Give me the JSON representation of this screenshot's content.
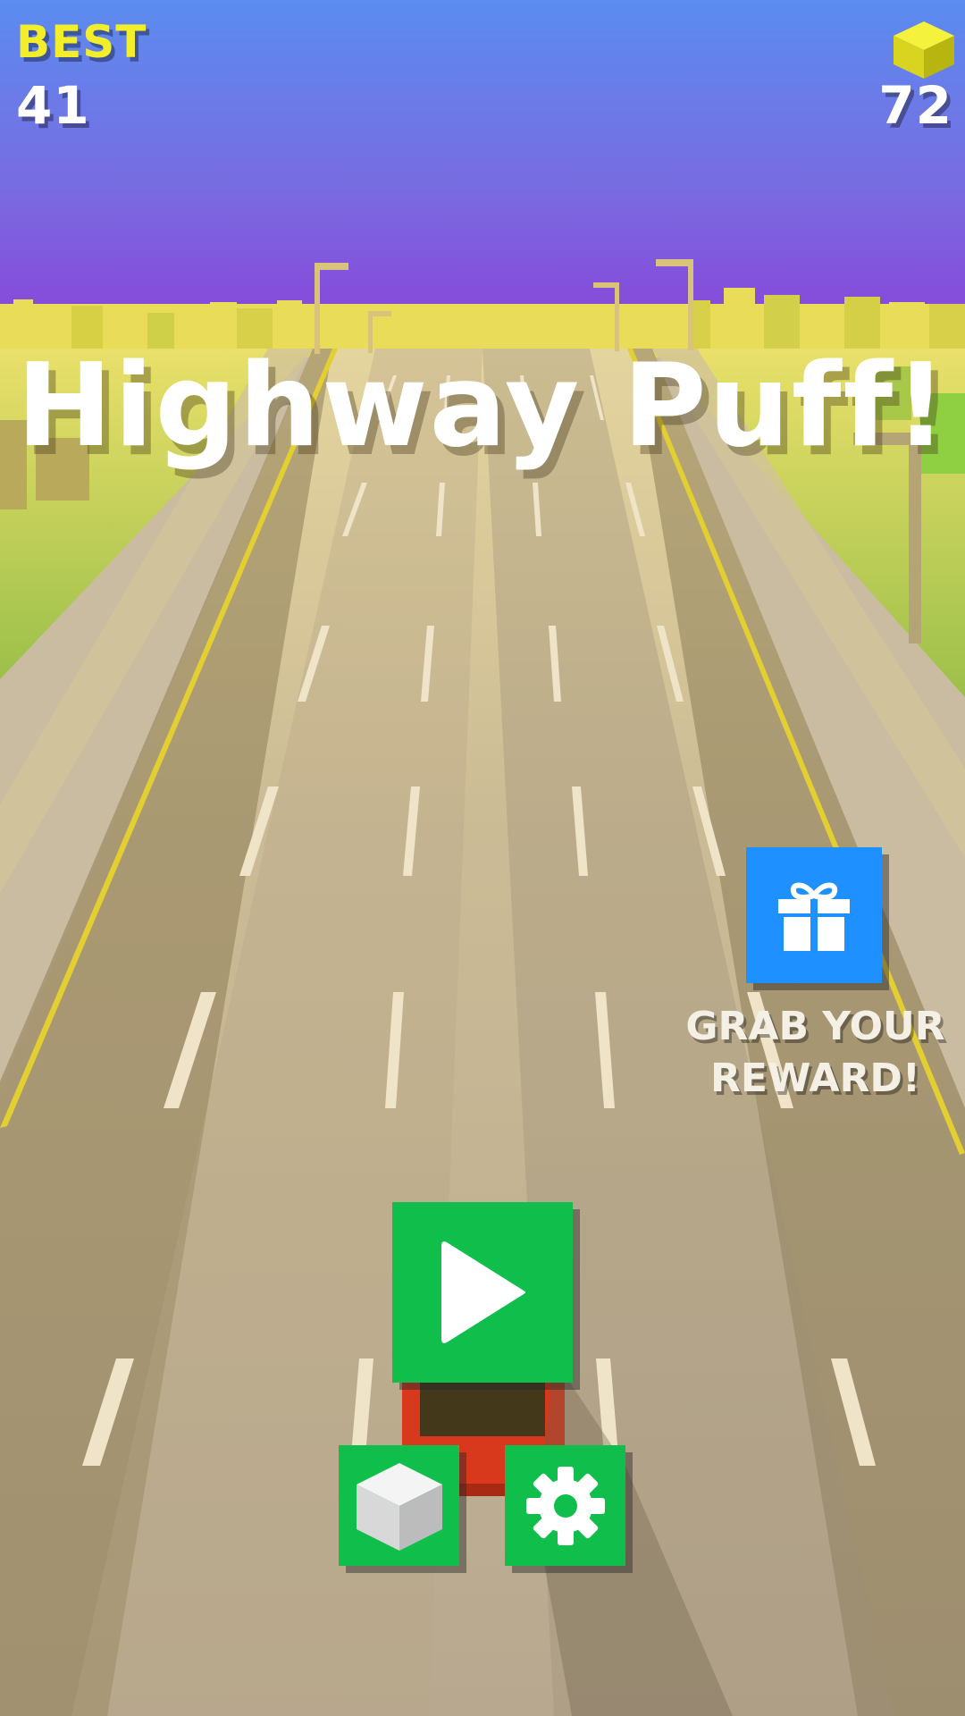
{
  "hud": {
    "best_label": "BEST",
    "best_value": "41",
    "coin_count": "72",
    "coin_icon": "yellow-cube-icon"
  },
  "title": "Highway Puff!",
  "reward": {
    "label_line1": "GRAB YOUR",
    "label_line2": "REWARD!",
    "icon": "gift-icon"
  },
  "buttons": {
    "play_icon": "play-icon",
    "shop_icon": "cube-icon",
    "settings_icon": "gear-icon"
  },
  "colors": {
    "sky_top": "#5b8cf0",
    "sky_bottom": "#8a3fd8",
    "button_green": "#10be4c",
    "reward_blue": "#1e90ff",
    "best_yellow": "#f2ee2a",
    "car_red": "#d8381c"
  }
}
